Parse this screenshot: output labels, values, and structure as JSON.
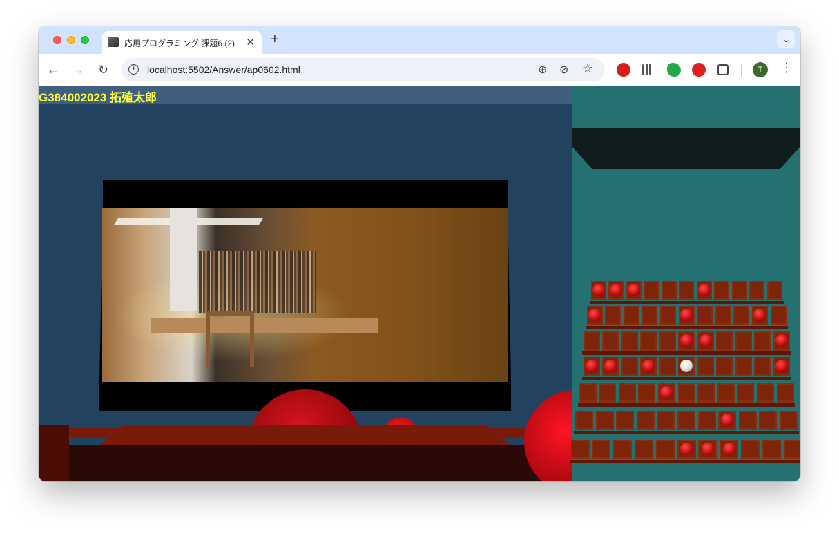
{
  "browser": {
    "tab_title": "応用プログラミング 課題6 (2)",
    "tab_close": "✕",
    "new_tab": "+",
    "tab_menu": "⌄",
    "url": "localhost:5502/Answer/ap0602.html",
    "avatar_letter": "T",
    "nav": {
      "back": "←",
      "forward": "→",
      "reload": "↻"
    },
    "omnibox_icons": {
      "zoom": "⊕",
      "hide": "⊘",
      "star": "☆"
    },
    "menu": "⋮"
  },
  "page": {
    "student_label": "G384002023 拓殖太郎",
    "accent_color": "#ffff3c"
  },
  "seat_map": {
    "rows": [
      [
        1,
        1,
        1,
        0,
        0,
        0,
        1,
        0,
        0,
        0,
        0
      ],
      [
        1,
        0,
        0,
        0,
        0,
        1,
        0,
        0,
        0,
        1,
        0
      ],
      [
        0,
        0,
        0,
        0,
        0,
        1,
        1,
        0,
        0,
        0,
        1
      ],
      [
        1,
        1,
        0,
        1,
        0,
        2,
        0,
        0,
        0,
        0,
        1
      ],
      [
        0,
        0,
        0,
        0,
        1,
        0,
        0,
        0,
        0,
        0,
        0
      ],
      [
        0,
        0,
        0,
        0,
        0,
        0,
        0,
        1,
        0,
        0,
        0
      ],
      [
        0,
        0,
        0,
        0,
        0,
        1,
        1,
        1,
        0,
        0,
        0
      ]
    ],
    "legend_colors": {
      "occupied": "#d1121a",
      "self": "#ffffff",
      "empty": "#8a2d0c"
    }
  }
}
